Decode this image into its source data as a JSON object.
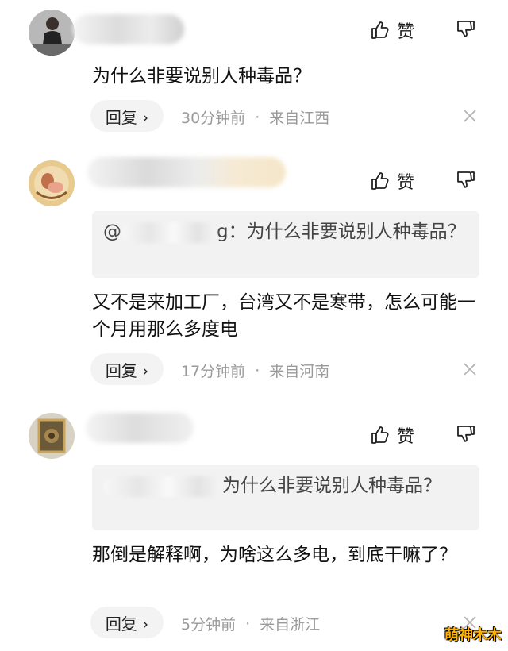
{
  "actions": {
    "like_label": "赞",
    "reply_label": "回复 ›"
  },
  "comments": [
    {
      "quote": null,
      "text": "为什么非要说别人种毒品？",
      "time": "30分钟前",
      "separator": "·",
      "location": "来自江西"
    },
    {
      "quote": {
        "prefix": "@",
        "suffix": "g：为什么非要说别人种毒品？"
      },
      "text": "又不是来加工厂，台湾又不是寒带，怎么可能一个月用那么多度电",
      "time": "17分钟前",
      "separator": "·",
      "location": "来自河南"
    },
    {
      "quote": {
        "prefix": "",
        "suffix": "为什么非要说别人种毒品？"
      },
      "text": "那倒是解释啊，为啥这么多电，到底干嘛了？",
      "time": "5分钟前",
      "separator": "·",
      "location": "来自浙江"
    }
  ],
  "watermark": "萌神木木",
  "colors": {
    "meta": "#9a9a9a",
    "quote_bg": "#f2f2f2",
    "reply_bg": "#f3f3f3",
    "watermark": "#ffb300"
  }
}
